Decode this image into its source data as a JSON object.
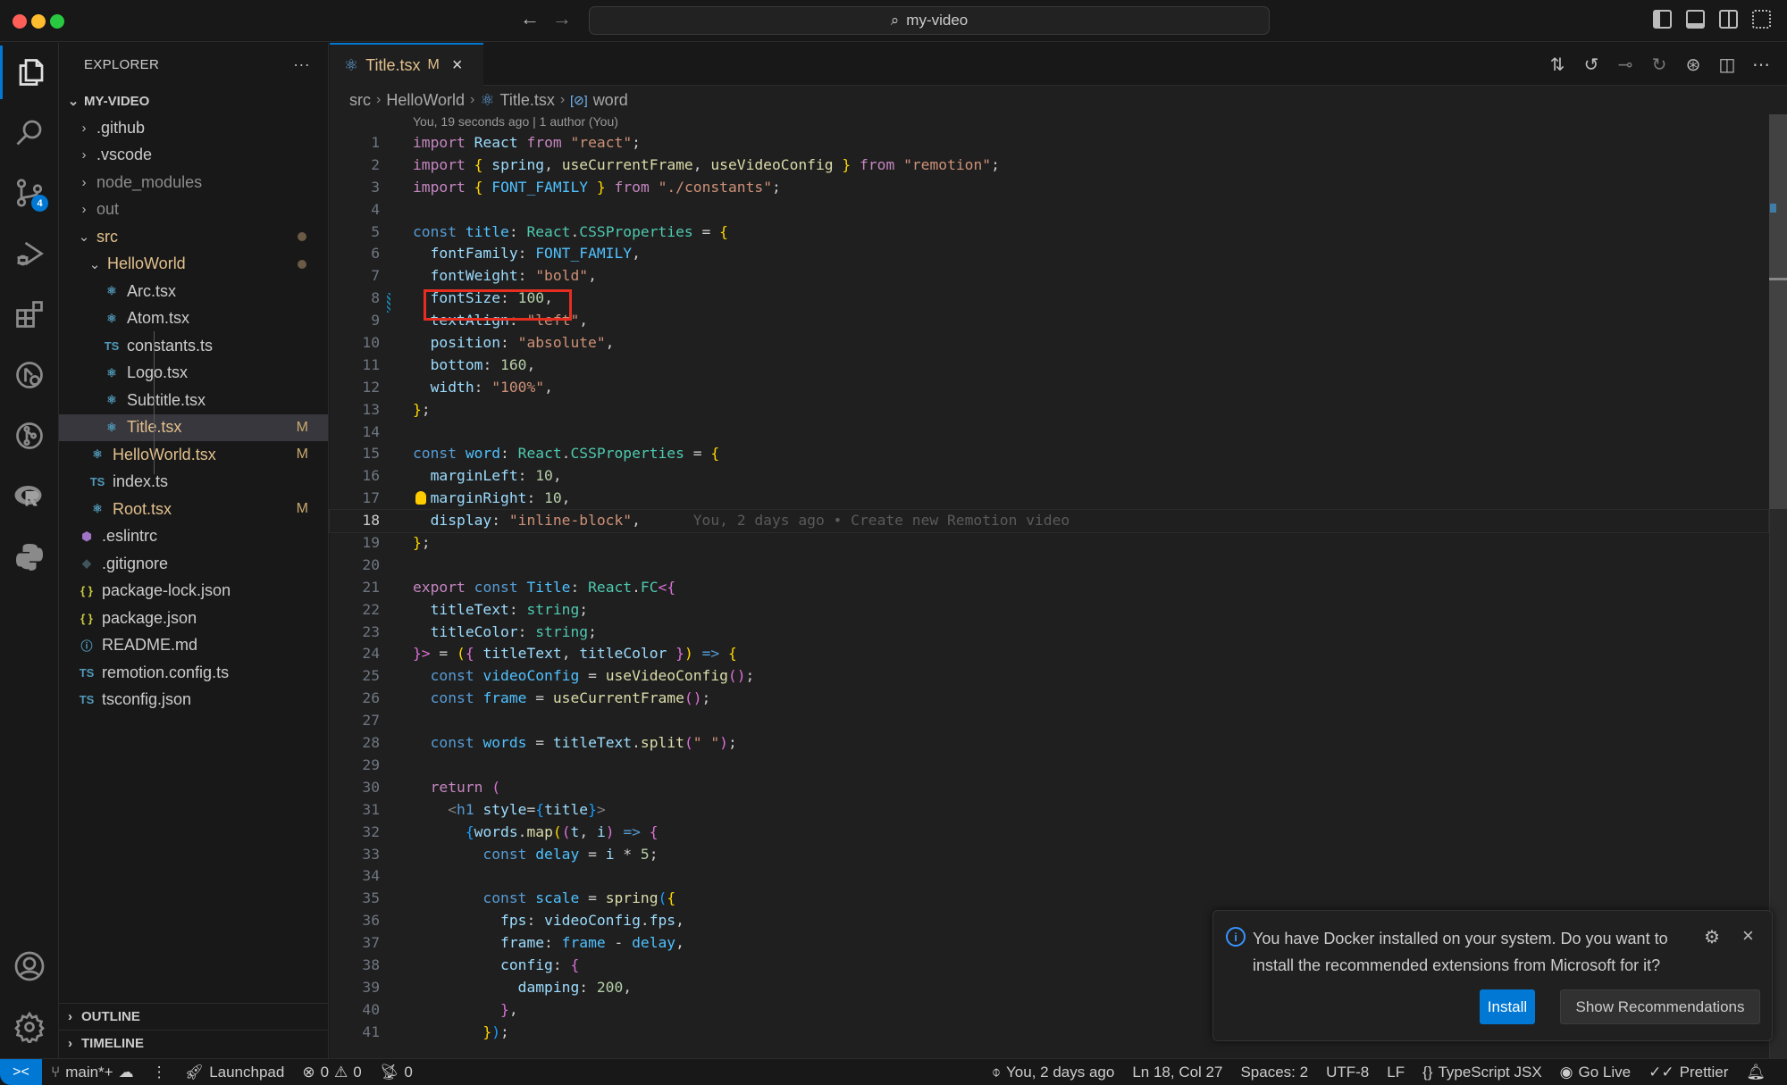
{
  "window": {
    "title": "my-video"
  },
  "activity_bar": {
    "source_control_badge": "4"
  },
  "sidebar": {
    "title": "EXPLORER",
    "more": "···",
    "root": "MY-VIDEO",
    "items": [
      {
        "label": ".github",
        "kind": "folder",
        "expanded": false
      },
      {
        "label": ".vscode",
        "kind": "folder",
        "expanded": false
      },
      {
        "label": "node_modules",
        "kind": "folder",
        "expanded": false
      },
      {
        "label": "out",
        "kind": "folder",
        "expanded": false
      },
      {
        "label": "src",
        "kind": "folder",
        "expanded": true
      },
      {
        "label": "HelloWorld",
        "kind": "folder",
        "expanded": true
      },
      {
        "label": "Arc.tsx",
        "icon": "react"
      },
      {
        "label": "Atom.tsx",
        "icon": "react"
      },
      {
        "label": "constants.ts",
        "icon": "TS"
      },
      {
        "label": "Logo.tsx",
        "icon": "react"
      },
      {
        "label": "Subtitle.tsx",
        "icon": "react"
      },
      {
        "label": "Title.tsx",
        "icon": "react",
        "status": "M"
      },
      {
        "label": "HelloWorld.tsx",
        "icon": "react",
        "status": "M"
      },
      {
        "label": "index.ts",
        "icon": "TS"
      },
      {
        "label": "Root.tsx",
        "icon": "react",
        "status": "M"
      },
      {
        "label": ".eslintrc",
        "icon": "eslint"
      },
      {
        "label": ".gitignore",
        "icon": "git"
      },
      {
        "label": "package-lock.json",
        "icon": "{}"
      },
      {
        "label": "package.json",
        "icon": "{}"
      },
      {
        "label": "README.md",
        "icon": "info"
      },
      {
        "label": "remotion.config.ts",
        "icon": "TS"
      },
      {
        "label": "tsconfig.json",
        "icon": "TS"
      }
    ],
    "outline": "OUTLINE",
    "timeline": "TIMELINE"
  },
  "editor": {
    "tab": {
      "label": "Title.tsx",
      "status": "M",
      "close": "×"
    },
    "breadcrumb": [
      "src",
      "HelloWorld",
      "Title.tsx",
      "word"
    ],
    "codelens": "You, 19 seconds ago | 1 author (You)",
    "blame_inline": "You, 2 days ago • Create new Remotion video",
    "current_line": 18,
    "highlighted_line": 9
  },
  "notification": {
    "message": "You have Docker installed on your system. Do you want to install the recommended extensions from Microsoft for it?",
    "install_label": "Install",
    "recommendations_label": "Show Recommendations"
  },
  "status_bar": {
    "branch": "main*+",
    "launchpad": "Launchpad",
    "errors": "0",
    "warnings": "0",
    "ports": "0",
    "blame": "You, 2 days ago",
    "position": "Ln 18, Col 27",
    "spaces": "Spaces: 2",
    "encoding": "UTF-8",
    "eol": "LF",
    "language": "TypeScript JSX",
    "go_live": "Go Live",
    "prettier": "Prettier"
  }
}
